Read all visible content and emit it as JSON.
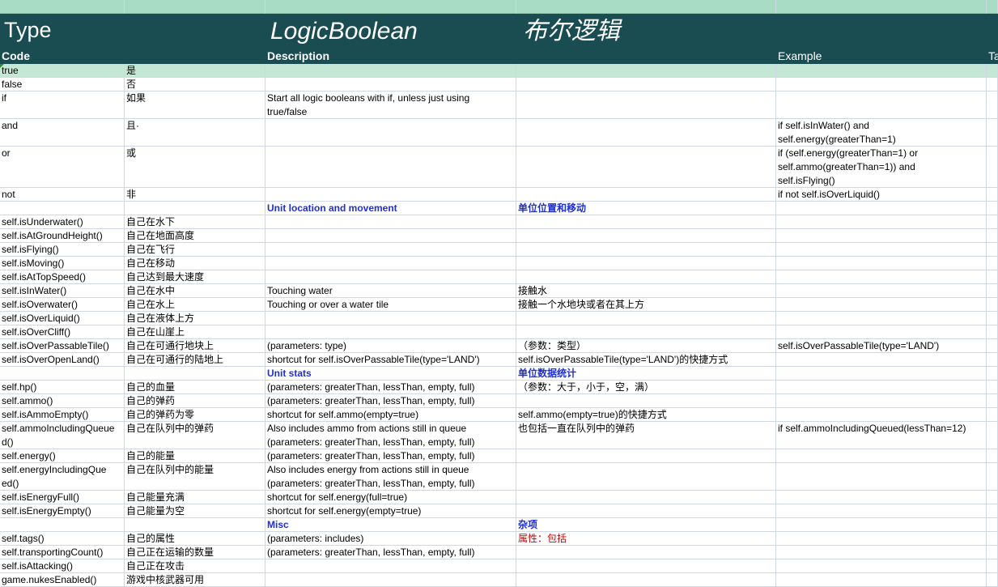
{
  "banner": {
    "type_label": "Type",
    "type_name": "LogicBoolean",
    "type_name_cn": "布尔逻辑"
  },
  "header": {
    "code": "Code",
    "description": "Description",
    "example": "Example",
    "extra": "Ta"
  },
  "rows": [
    {
      "code": "true",
      "cn": "是",
      "desc": "",
      "desc_cn": "",
      "example": ""
    },
    {
      "code": "false",
      "cn": "否",
      "desc": "",
      "desc_cn": "",
      "example": ""
    },
    {
      "code": "if",
      "cn": "如果",
      "desc": "Start all logic booleans with if, unless just using\ntrue/false",
      "desc_cn": "",
      "example": ""
    },
    {
      "code": "and",
      "cn": "且·",
      "desc": "",
      "desc_cn": "",
      "example": "if self.isInWater() and\nself.energy(greaterThan=1)"
    },
    {
      "code": "or",
      "cn": "或",
      "desc": "",
      "desc_cn": "",
      "example": "if (self.energy(greaterThan=1) or\nself.ammo(greaterThan=1)) and\nself.isFlying()"
    },
    {
      "code": "not",
      "cn": "非",
      "desc": "",
      "desc_cn": "",
      "example": "if not self.isOverLiquid()"
    },
    {
      "code": "",
      "cn": "",
      "desc": "Unit location and movement",
      "desc_cn": "单位位置和移动",
      "example": ""
    },
    {
      "code": "self.isUnderwater()",
      "cn": "自己在水下",
      "desc": "",
      "desc_cn": "",
      "example": ""
    },
    {
      "code": "self.isAtGroundHeight()",
      "cn": "自己在地面高度",
      "desc": "",
      "desc_cn": "",
      "example": ""
    },
    {
      "code": "self.isFlying()",
      "cn": "自己在飞行",
      "desc": "",
      "desc_cn": "",
      "example": ""
    },
    {
      "code": "self.isMoving()",
      "cn": "自己在移动",
      "desc": "",
      "desc_cn": "",
      "example": ""
    },
    {
      "code": "self.isAtTopSpeed()",
      "cn": "自己达到最大速度",
      "desc": "",
      "desc_cn": "",
      "example": ""
    },
    {
      "code": "self.isInWater()",
      "cn": "自己在水中",
      "desc": "Touching water",
      "desc_cn": "接触水",
      "example": ""
    },
    {
      "code": "self.isOverwater()",
      "cn": "自己在水上",
      "desc": "Touching or over a water tile",
      "desc_cn": "接触一个水地块或者在其上方",
      "example": ""
    },
    {
      "code": "self.isOverLiquid()",
      "cn": "自己在液体上方",
      "desc": "",
      "desc_cn": "",
      "example": ""
    },
    {
      "code": "self.isOverCliff()",
      "cn": "自己在山崖上",
      "desc": "",
      "desc_cn": "",
      "example": ""
    },
    {
      "code": "self.isOverPassableTile()",
      "cn": "自己在可通行地块上",
      "desc": "(parameters: type)",
      "desc_cn": "（参数：类型）",
      "example": "self.isOverPassableTile(type='LAND')"
    },
    {
      "code": "self.isOverOpenLand()",
      "cn": "自己在可通行的陆地上",
      "desc": "shortcut for self.isOverPassableTile(type='LAND')",
      "desc_cn": "self.isOverPassableTile(type='LAND')的快捷方式",
      "example": ""
    },
    {
      "code": "",
      "cn": "",
      "desc": "Unit stats",
      "desc_cn": "单位数据统计",
      "example": ""
    },
    {
      "code": "self.hp()",
      "cn": "自己的血量",
      "desc": "(parameters: greaterThan, lessThan, empty, full)",
      "desc_cn": "（参数：大于，小于，空，满）",
      "example": ""
    },
    {
      "code": "self.ammo()",
      "cn": "自己的弹药",
      "desc": "(parameters: greaterThan, lessThan, empty, full)",
      "desc_cn": "",
      "example": ""
    },
    {
      "code": "self.isAmmoEmpty()",
      "cn": "自己的弹药为零",
      "desc": "shortcut for self.ammo(empty=true)",
      "desc_cn": "self.ammo(empty=true)的快捷方式",
      "example": ""
    },
    {
      "code": "self.ammoIncludingQueue\nd()",
      "cn": "自己在队列中的弹药",
      "desc": "Also includes ammo from actions still in queue\n(parameters: greaterThan, lessThan, empty, full)",
      "desc_cn": "也包括一直在队列中的弹药",
      "example": "if self.ammoIncludingQueued(lessThan=12)"
    },
    {
      "code": "self.energy()",
      "cn": "自己的能量",
      "desc": "(parameters: greaterThan, lessThan, empty, full)",
      "desc_cn": "",
      "example": ""
    },
    {
      "code": "self.energyIncludingQue\ned()",
      "cn": "自己在队列中的能量",
      "desc": "Also includes energy from actions still in queue\n(parameters: greaterThan, lessThan, empty, full)",
      "desc_cn": "",
      "example": ""
    },
    {
      "code": "self.isEnergyFull()",
      "cn": "自己能量充满",
      "desc": "shortcut for self.energy(full=true)",
      "desc_cn": "",
      "example": ""
    },
    {
      "code": "self.isEnergyEmpty()",
      "cn": "自己能量为空",
      "desc": "shortcut for self.energy(empty=true)",
      "desc_cn": "",
      "example": ""
    },
    {
      "code": "",
      "cn": "",
      "desc": "Misc",
      "desc_cn": "杂项",
      "example": ""
    },
    {
      "code": "self.tags()",
      "cn": "自己的属性",
      "desc": "(parameters: includes)",
      "desc_cn": "属性：包括",
      "example": ""
    },
    {
      "code": "self.transportingCount()",
      "cn": "自己正在运输的数量",
      "desc": "(parameters: greaterThan, lessThan, empty, full)",
      "desc_cn": "",
      "example": ""
    },
    {
      "code": "self.isAttacking()",
      "cn": "自己正在攻击",
      "desc": "",
      "desc_cn": "",
      "example": ""
    },
    {
      "code": "game.nukesEnabled()",
      "cn": "游戏中核武器可用",
      "desc": "",
      "desc_cn": "",
      "example": ""
    }
  ]
}
